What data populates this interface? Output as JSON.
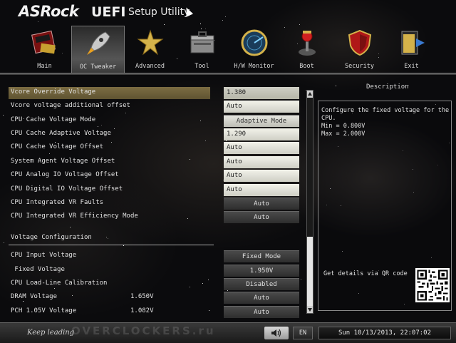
{
  "header": {
    "brand": "ASRock",
    "uefi": "UEFI",
    "subtitle": "Setup Utility"
  },
  "nav": {
    "active": "OC Tweaker",
    "items": [
      {
        "label": "Main",
        "icon": "main-icon"
      },
      {
        "label": "OC Tweaker",
        "icon": "rocket-icon"
      },
      {
        "label": "Advanced",
        "icon": "star-icon"
      },
      {
        "label": "Tool",
        "icon": "toolbox-icon"
      },
      {
        "label": "H/W Monitor",
        "icon": "radar-icon"
      },
      {
        "label": "Boot",
        "icon": "joystick-icon"
      },
      {
        "label": "Security",
        "icon": "shield-icon"
      },
      {
        "label": "Exit",
        "icon": "exit-icon"
      }
    ]
  },
  "settings": {
    "rows": [
      {
        "label": "Vcore Override Voltage",
        "value": "1.380",
        "kind": "input",
        "selected": true
      },
      {
        "label": "Vcore voltage additional offset",
        "value": "Auto",
        "kind": "input"
      },
      {
        "label": "CPU Cache Voltage Mode",
        "value": "Adaptive Mode",
        "kind": "option-light"
      },
      {
        "label": "CPU Cache Adaptive Voltage",
        "value": "1.290",
        "kind": "input"
      },
      {
        "label": "CPU Cache Voltage Offset",
        "value": "Auto",
        "kind": "input"
      },
      {
        "label": "System Agent Voltage Offset",
        "value": "Auto",
        "kind": "input"
      },
      {
        "label": "CPU Analog IO Voltage Offset",
        "value": "Auto",
        "kind": "input"
      },
      {
        "label": "CPU Digital IO Voltage Offset",
        "value": "Auto",
        "kind": "input"
      },
      {
        "label": "CPU Integrated VR Faults",
        "value": "Auto",
        "kind": "option"
      },
      {
        "label": "CPU Integrated VR Efficiency Mode",
        "value": "Auto",
        "kind": "option"
      }
    ],
    "section_title": "Voltage Configuration",
    "rows2": [
      {
        "label": "CPU Input Voltage",
        "value": "Fixed Mode",
        "kind": "option"
      },
      {
        "label": " Fixed Voltage",
        "value": "1.950V",
        "kind": "option"
      },
      {
        "label": "CPU Load-Line Calibration",
        "value": "Disabled",
        "kind": "option"
      },
      {
        "label": "DRAM Voltage",
        "reading": "1.650V",
        "value": "Auto",
        "kind": "option"
      },
      {
        "label": "PCH 1.05V Voltage",
        "reading": "1.082V",
        "value": "Auto",
        "kind": "option"
      }
    ]
  },
  "description": {
    "title": "Description",
    "text": "Configure the fixed voltage for the CPU.\nMin = 0.800V\nMax = 2.000V",
    "qr_label": "Get details via QR code"
  },
  "footer": {
    "slogan": "Keep leading",
    "watermark": "OVERCLOCKERS.ru",
    "language": "EN",
    "datetime": "Sun 10/13/2013, 22:07:02"
  }
}
